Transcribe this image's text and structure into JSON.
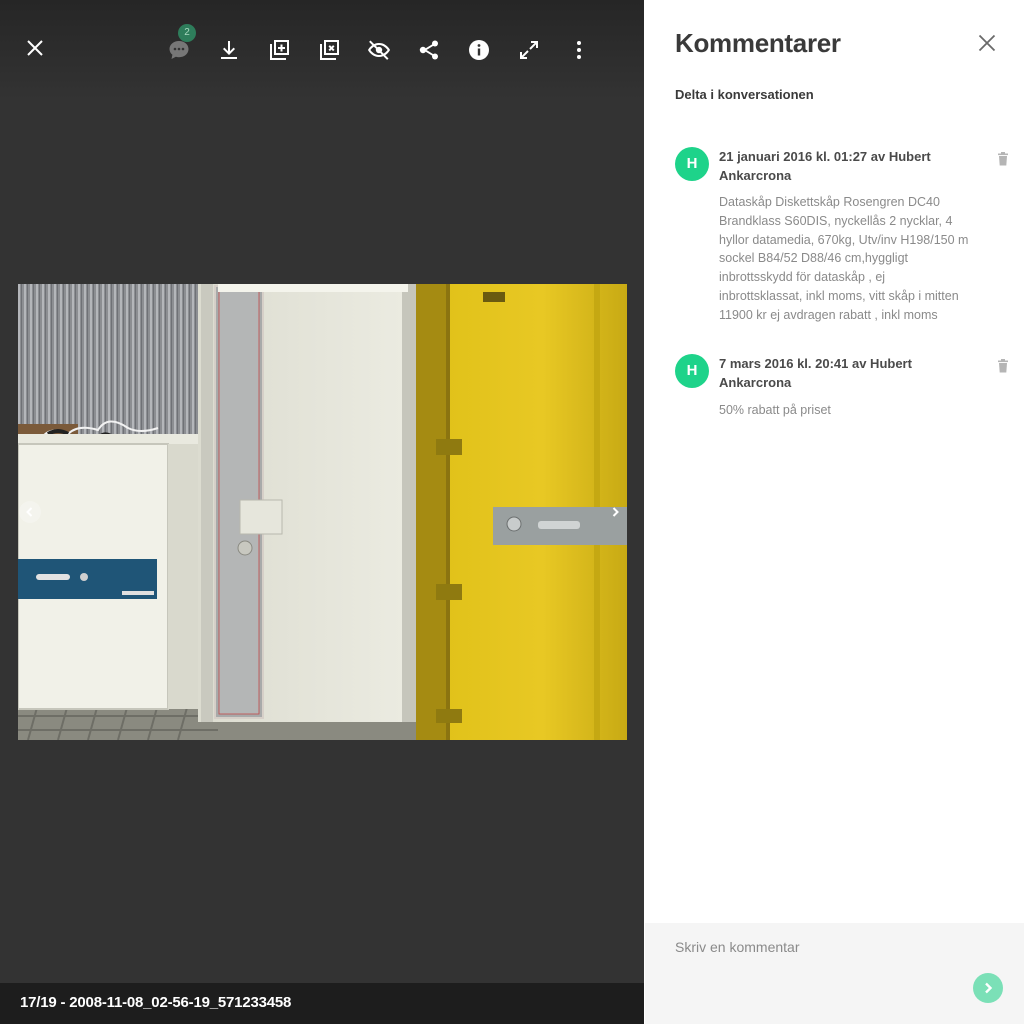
{
  "viewer": {
    "toolbar": {
      "comments_count": "2",
      "icons": [
        "close-icon",
        "comment-icon",
        "download-icon",
        "add-to-album-icon",
        "remove-from-album-icon",
        "hide-icon",
        "share-icon",
        "info-icon",
        "fullscreen-icon",
        "more-vert-icon"
      ]
    },
    "footer_caption": "17/19 - 2008-11-08_02-56-19_571233458"
  },
  "comments_panel": {
    "title": "Kommentarer",
    "subtitle": "Delta i konversationen",
    "comments": [
      {
        "avatar_initial": "H",
        "meta": "21 januari 2016 kl. 01:27 av Hubert Ankarcrona",
        "body": "Dataskåp Diskettskåp Rosengren DC40 Brandklass S60DIS, nyckellås 2 nycklar, 4 hyllor datamedia, 670kg, Utv/inv H198/150 m sockel B84/52 D88/46 cm,hyggligt inbrottsskydd för dataskåp , ej inbrottsklassat, inkl moms, vitt skåp i mitten 11900 kr ej avdragen rabatt , inkl moms"
      },
      {
        "avatar_initial": "H",
        "meta": "7 mars 2016 kl. 20:41 av Hubert Ankarcrona",
        "body": "50% rabatt på priset"
      }
    ],
    "composer_placeholder": "Skriv en kommentar"
  },
  "colors": {
    "avatar": "#1ed38a",
    "send_button": "#7be0b7",
    "viewer_background": "#333333",
    "badge": "#2e7d5b"
  }
}
